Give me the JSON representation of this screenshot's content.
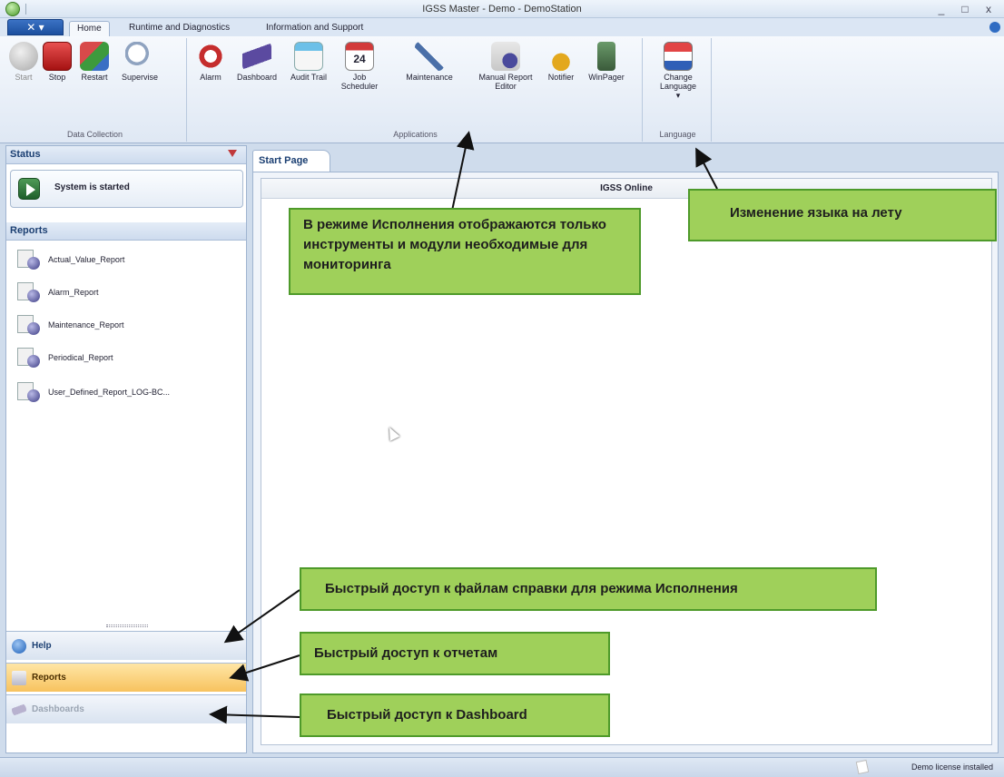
{
  "window": {
    "title": "IGSS Master - Demo - DemoStation",
    "minimize_glyph": "_",
    "maximize_glyph": "□",
    "close_glyph": "x"
  },
  "ribbon_tabs": {
    "home": "Home",
    "runtime": "Runtime and Diagnostics",
    "info": "Information and Support"
  },
  "ribbon": {
    "data_collection": {
      "label": "Data Collection",
      "buttons": {
        "start": "Start",
        "stop": "Stop",
        "restart": "Restart",
        "supervise": "Supervise"
      }
    },
    "applications": {
      "label": "Applications",
      "buttons": {
        "alarm": "Alarm",
        "dashboard": "Dashboard",
        "audit_trail": "Audit Trail",
        "job_scheduler": "Job Scheduler",
        "maintenance": "Maintenance",
        "manual_report_editor": "Manual Report Editor",
        "notifier": "Notifier",
        "winpager": "WinPager"
      },
      "calendar_day": "24"
    },
    "language": {
      "label": "Language",
      "change_language": "Change Language",
      "dropdown_glyph": "▾"
    }
  },
  "left_panel": {
    "status_header": "Status",
    "status_text": "System is started",
    "reports_header": "Reports",
    "reports": [
      "Actual_Value_Report",
      "Alarm_Report",
      "Maintenance_Report",
      "Periodical_Report",
      "User_Defined_Report_LOG-BC..."
    ],
    "nav": {
      "help": "Help",
      "reports": "Reports",
      "dashboards": "Dashboards"
    }
  },
  "content": {
    "tab": "Start Page",
    "header": "IGSS Online"
  },
  "statusbar": {
    "license": "Demo license installed"
  },
  "callouts": {
    "runtime": "В режиме Исполнения отображаются только инструменты и модули необходимые для мониторинга",
    "language": "Изменение языка на лету",
    "help": "Быстрый доступ к файлам справки для режима Исполнения",
    "reports": "Быстрый доступ к отчетам",
    "dashboard": "Быстрый доступ к Dashboard"
  },
  "colors": {
    "callout_fill": "#9fd05a",
    "callout_border": "#4e9a2a",
    "ribbon_blue": "#1c4f9e",
    "selected_nav": "#f7c25e"
  }
}
